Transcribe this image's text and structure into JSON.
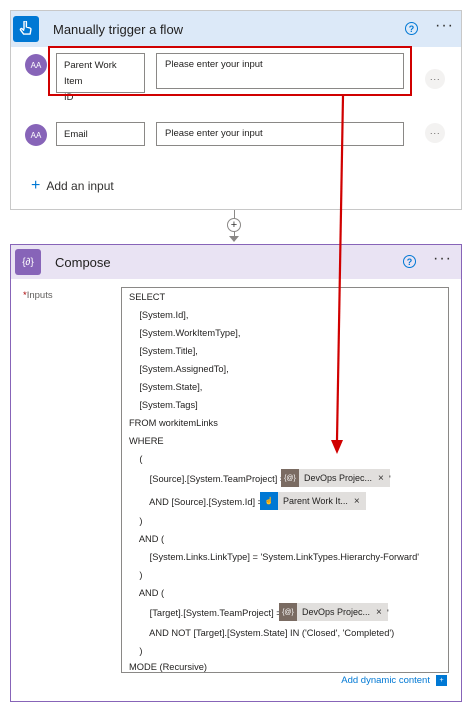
{
  "trigger": {
    "title": "Manually trigger a flow",
    "help_icon": "?",
    "more_icon": "···",
    "fields": [
      {
        "avatar": "AA",
        "label_line1": "Parent Work Item",
        "label_line2": "ID",
        "placeholder": "Please enter your input",
        "more": "···"
      },
      {
        "avatar": "AA",
        "label_line1": "Email",
        "label_line2": "",
        "placeholder": "Please enter your input",
        "more": "···"
      }
    ],
    "add_input_plus": "+",
    "add_input_label": "Add an input"
  },
  "connector": {
    "plus": "+"
  },
  "compose": {
    "title": "Compose",
    "icon_text": "{∂}",
    "help_icon": "?",
    "more_icon": "···",
    "inputs_required": "*",
    "inputs_label": "Inputs",
    "lines": [
      "SELECT",
      "    [System.Id],",
      "    [System.WorkItemType],",
      "    [System.Title],",
      "    [System.AssignedTo],",
      "    [System.State],",
      "    [System.Tags]",
      "FROM workitemLinks",
      "WHERE",
      "    (",
      "        [Source].[System.TeamProject] = '",
      "        AND [Source].[System.Id] =",
      "    )",
      "    AND (",
      "        [System.Links.LinkType] = 'System.LinkTypes.Hierarchy-Forward'",
      "    )",
      "    AND (",
      "        [Target].[System.TeamProject] = '",
      "        AND NOT [Target].[System.State] IN ('Closed', 'Completed')",
      "    )",
      "MODE (Recursive)"
    ],
    "tokens": [
      {
        "icon": "{@}",
        "text": "DevOps Projec...",
        "close": "×",
        "after": "'"
      },
      {
        "icon": "☝",
        "text": "Parent Work It...",
        "close": "×",
        "after": ""
      },
      {
        "icon": "{@}",
        "text": "DevOps Projec...",
        "close": "×",
        "after": "'"
      }
    ],
    "add_dynamic": "Add dynamic content",
    "add_dynamic_icon": "+"
  },
  "colors": {
    "accent": "#0078d4",
    "compose_accent": "#8764b8",
    "highlight": "#d00000"
  }
}
